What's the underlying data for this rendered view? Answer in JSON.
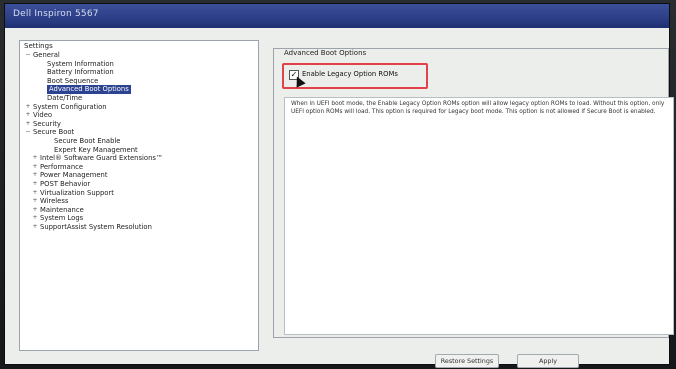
{
  "window": {
    "title": "Dell Inspiron 5567"
  },
  "settings": {
    "header": "Settings",
    "items": [
      {
        "label": "General",
        "indent": 1,
        "expander": "−"
      },
      {
        "label": "System Information",
        "indent": 3,
        "expander": ""
      },
      {
        "label": "Battery Information",
        "indent": 3,
        "expander": ""
      },
      {
        "label": "Boot Sequence",
        "indent": 3,
        "expander": ""
      },
      {
        "label": "Advanced Boot Options",
        "indent": 3,
        "expander": "",
        "selected": true
      },
      {
        "label": "Date/Time",
        "indent": 3,
        "expander": ""
      },
      {
        "label": "System Configuration",
        "indent": 1,
        "expander": "+"
      },
      {
        "label": "Video",
        "indent": 1,
        "expander": "+"
      },
      {
        "label": "Security",
        "indent": 1,
        "expander": "+"
      },
      {
        "label": "Secure Boot",
        "indent": 1,
        "expander": "−"
      },
      {
        "label": "Secure Boot Enable",
        "indent": 4,
        "expander": ""
      },
      {
        "label": "Expert Key Management",
        "indent": 4,
        "expander": ""
      },
      {
        "label": "Intel® Software Guard Extensions™",
        "indent": 2,
        "expander": "+"
      },
      {
        "label": "Performance",
        "indent": 2,
        "expander": "+"
      },
      {
        "label": "Power Management",
        "indent": 2,
        "expander": "+"
      },
      {
        "label": "POST Behavior",
        "indent": 2,
        "expander": "+"
      },
      {
        "label": "Virtualization Support",
        "indent": 2,
        "expander": "+"
      },
      {
        "label": "Wireless",
        "indent": 2,
        "expander": "+"
      },
      {
        "label": "Maintenance",
        "indent": 2,
        "expander": "+"
      },
      {
        "label": "System Logs",
        "indent": 2,
        "expander": "+"
      },
      {
        "label": "SupportAssist System Resolution",
        "indent": 2,
        "expander": "+"
      }
    ]
  },
  "advanced_boot": {
    "group_title": "Advanced Boot Options",
    "option_label": "Enable Legacy Option ROMs",
    "option_checked": true,
    "description": "When in UEFI boot mode, the Enable Legacy Option ROMs option will allow legacy option ROMs to load. Without this option, only UEFI option ROMs will load. This option is required for Legacy boot mode. This option is not allowed if Secure Boot is enabled."
  },
  "buttons": {
    "restore": "Restore Settings",
    "apply": "Apply"
  },
  "colors": {
    "titlebar": "#2c3e86",
    "selection": "#2b4390",
    "highlight": "#e2424a"
  }
}
